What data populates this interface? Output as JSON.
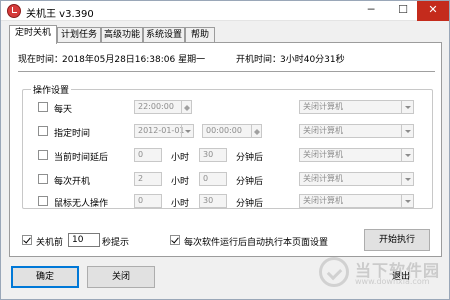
{
  "window": {
    "title": "关机王 v3.390",
    "min_glyph": "─",
    "max_glyph": "☐",
    "close_glyph": "✕"
  },
  "tabs": [
    "定时关机",
    "计划任务",
    "高级功能",
    "系统设置",
    "帮助"
  ],
  "info": {
    "current_time_label": "现在时间：",
    "current_time": "2018年05月28日16:38:06 星期一",
    "uptime_label": "开机时间：",
    "uptime": "3小时40分31秒"
  },
  "group": {
    "title": "操作设置",
    "rows": [
      {
        "label": "每天",
        "checked": false,
        "time": "22:00:00",
        "action": "关闭计算机"
      },
      {
        "label": "指定时间",
        "checked": false,
        "date": "2012-01-01",
        "time": "00:00:00",
        "action": "关闭计算机"
      },
      {
        "label": "当前时间延后",
        "checked": false,
        "hours": "0",
        "hours_unit": "小时",
        "minutes": "30",
        "minutes_unit": "分钟后",
        "action": "关闭计算机"
      },
      {
        "label": "每次开机",
        "checked": false,
        "hours": "2",
        "hours_unit": "小时",
        "minutes": "0",
        "minutes_unit": "分钟后",
        "action": "关闭计算机"
      },
      {
        "label": "鼠标无人操作",
        "checked": false,
        "hours": "0",
        "hours_unit": "小时",
        "minutes": "30",
        "minutes_unit": "分钟后",
        "action": "关闭计算机"
      }
    ]
  },
  "bottom": {
    "prealert_label": "关机前",
    "prealert_checked": true,
    "prealert_seconds": "10",
    "prealert_suffix": "秒提示",
    "autorun_label": "每次软件运行后自动执行本页面设置",
    "autorun_checked": true,
    "start_button": "开始执行"
  },
  "footer": {
    "ok_button": "确定",
    "close_button": "关闭",
    "exit_button": "退出"
  },
  "watermark": {
    "name": "当下软件园",
    "sub": "www.downxia.com"
  },
  "colors": {
    "close_red": "#c42b1c",
    "icon_red": "#d63b3b",
    "default_button_border": "#0078d7"
  }
}
